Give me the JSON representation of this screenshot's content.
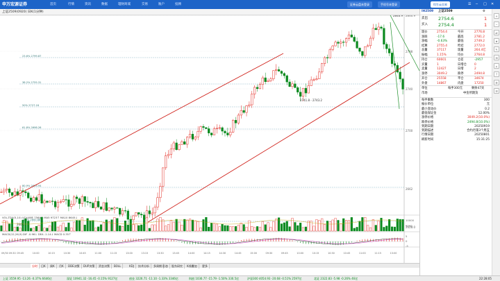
{
  "app": {
    "logo": "申万宏源证券"
  },
  "nav": [
    "首页",
    "行情",
    "资讯",
    "数据",
    "理财商城",
    "交易",
    "账户",
    "投顾"
  ],
  "topbar_buttons": [
    "证券云盘未登录",
    "手机号未登录",
    "恒生云交易"
  ],
  "subtitle": "上证2509(0920) 日K(1分钟)",
  "chart": {
    "price_levels": [
      "2860.9",
      "2798",
      "2740",
      "2700",
      "2662",
      "2628.0"
    ],
    "fib_labels": [
      "23.6% 2799.87",
      "38.2% 2755.31",
      "50% 2727.16",
      "61.8% 2698.26",
      "80.9% 2653.94",
      "100% 2600.88"
    ],
    "annotation_top": "2846.9",
    "annotation_mid": "2741.8 - 2743.2",
    "annotation_low": "2600.9",
    "volume_label": "VOL-TDX(5,10) VOLUME 7564↑  MA5 9723↑  MA10 8645↓",
    "volume_levels": [
      "10000",
      "5000"
    ],
    "macd_label": "MACD(12,26,9) DIF -0.96↓  DEA -1.14↓  MACD 0.35↑",
    "macd_levels": [
      "5",
      "0",
      "-5"
    ],
    "time_labels": [
      "09/30 09:30",
      "09:45",
      "10:00",
      "10:15",
      "10:30",
      "10:45",
      "11:00",
      "11:15",
      "13:00",
      "13:15",
      "13:30",
      "13:45",
      "14:00",
      "14:15",
      "14:30",
      "14:45",
      "15:00",
      "09:30",
      "09:45",
      "10:00",
      "10:15",
      "10:30",
      "10:45",
      "11:00",
      "11:15",
      "13:00"
    ]
  },
  "quote": {
    "code": "IH2509",
    "name": "上证2509",
    "sell_label": "卖出",
    "sell_price": "2754.6",
    "sell_vol": "1",
    "buy_label": "买入",
    "buy_price": "2754.4",
    "buy_vol": "1",
    "rows": [
      [
        "现价",
        "2754.4",
        "今开",
        "2776.8"
      ],
      [
        "涨跌",
        "-17.6",
        "最高",
        "2781.2"
      ],
      [
        "涨幅",
        "-0.63%",
        "最低",
        "2749.2"
      ],
      [
        "结算",
        "2755.4",
        "昨结",
        "2772.0"
      ],
      [
        "总量",
        "37117",
        "现量",
        "264.4亿"
      ],
      [
        "振幅",
        "1.15%",
        "均价",
        "2764.8"
      ]
    ],
    "rows2": [
      [
        "持仓",
        "60601",
        "仓差",
        "-2957"
      ],
      [
        "买量",
        "1",
        "日增仓",
        "0"
      ],
      [
        "卖量",
        "12427",
        "日增",
        "2"
      ],
      [
        "涨停",
        "3049.2",
        "跌停",
        "2494.8"
      ]
    ],
    "rows3": [
      [
        "开仓",
        "25558",
        "平仓",
        "34674"
      ],
      [
        "外盘",
        "14867",
        "内盘",
        "17250"
      ]
    ],
    "unit_row": [
      "单位",
      "每手300元",
      "剩余47天"
    ],
    "market_row": [
      "市场",
      "中金所期货"
    ],
    "info_rows": [
      [
        "每手乘数",
        "300"
      ],
      [
        "报价单位",
        "元"
      ],
      [
        "最小变动价",
        "0.2"
      ],
      [
        "最低保证金",
        "12.00%"
      ],
      [
        "涨停价格",
        "3049.2(10.0%)"
      ],
      [
        "跌停价格",
        "2494.8(10.0%)"
      ],
      [
        "到期日期",
        "20250919"
      ],
      [
        "到期描述",
        "合约月第3个周五"
      ],
      [
        "行情日期",
        "20250801"
      ],
      [
        "刷新时间",
        "15:31:25"
      ]
    ]
  },
  "bottom_tabs": [
    "分时",
    "日K",
    "周K",
    "月K",
    "DDE决策",
    "DUP决策",
    "资金决策",
    "BOLL",
    "KDJ",
    "技术分析",
    "多周期",
    "形态",
    "股东研究",
    "K线叠加",
    "更多"
  ],
  "statusbar": [
    "上证 3559.95 -13.26 -0.37% 6646亿",
    "深证 10941.32 -16.45 -0.15% 9127亿",
    "创业 3226.71 -11.10 -1.33% 3346亿",
    "科创 1036.77 -15.79 -1.50% 330.5亿",
    "沪深300 4054.93 -20.68 -0.51% 2597亿",
    "北证 2322.83 -5.98 -0.26% 46亿",
    "22:28:05"
  ],
  "colors": {
    "brand": "#1d64c8",
    "up": "#e2231a",
    "down": "#0a8a1f",
    "channel": "#d0221b",
    "fall_channel": "#1e8f2a"
  }
}
